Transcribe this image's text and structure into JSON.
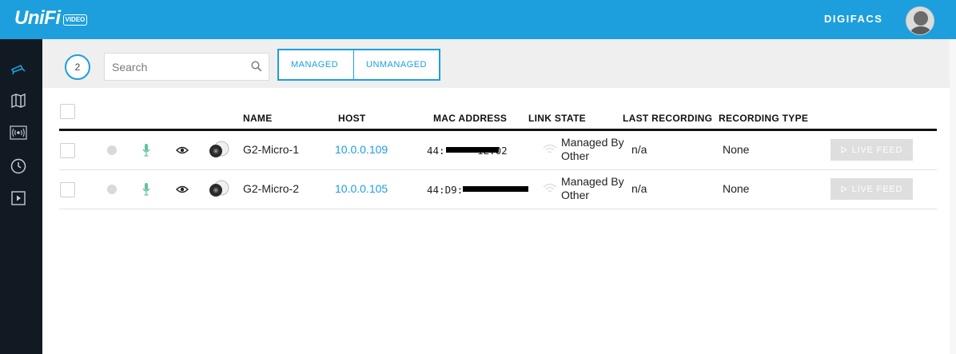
{
  "app": {
    "logo_text": "UniFi",
    "logo_badge": "VIDEO",
    "org_name": "DIGIFACS",
    "accent_color": "#1c9fdc",
    "sidebar_bg": "#111a22"
  },
  "sidebar": {
    "items": [
      {
        "icon": "camera-icon",
        "active": true
      },
      {
        "icon": "map-icon"
      },
      {
        "icon": "broadcast-icon"
      },
      {
        "icon": "clock-icon"
      },
      {
        "icon": "play-icon"
      }
    ]
  },
  "toolbar": {
    "count": "2",
    "search_placeholder": "Search",
    "filters": [
      "MANAGED",
      "UNMANAGED"
    ]
  },
  "table": {
    "columns": [
      "NAME",
      "HOST",
      "MAC ADDRESS",
      "LINK STATE",
      "LAST RECORDING",
      "RECORDING TYPE"
    ],
    "rows": [
      {
        "name": "G2-Micro-1",
        "host": "10.0.0.109",
        "mac_prefix": "44:",
        "mac_suffix": "1E:02",
        "link_state_line1": "Managed By",
        "link_state_line2": "Other",
        "last_recording": "n/a",
        "recording_type": "None",
        "action": "LIVE FEED"
      },
      {
        "name": "G2-Micro-2",
        "host": "10.0.0.105",
        "mac_prefix": "44:D9:",
        "mac_suffix": "",
        "link_state_line1": "Managed By",
        "link_state_line2": "Other",
        "last_recording": "n/a",
        "recording_type": "None",
        "action": "LIVE FEED"
      }
    ]
  }
}
